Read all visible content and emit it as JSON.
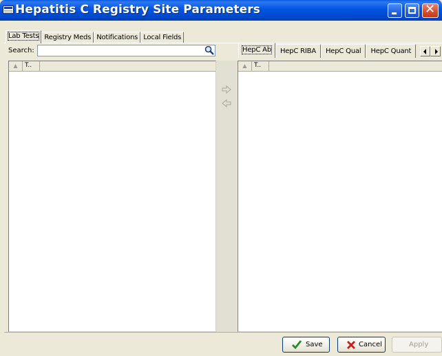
{
  "window": {
    "title": "Hepatitis C Registry Site Parameters"
  },
  "tabs": [
    {
      "label": "Lab Tests",
      "active": true
    },
    {
      "label": "Registry Meds"
    },
    {
      "label": "Notifications"
    },
    {
      "label": "Local Fields"
    }
  ],
  "search": {
    "label": "Search:",
    "value": ""
  },
  "left_grid": {
    "columns": [
      "T.."
    ]
  },
  "right_tabs": [
    {
      "label": "HepC Ab",
      "active": true
    },
    {
      "label": "HepC RIBA"
    },
    {
      "label": "HepC Qual"
    },
    {
      "label": "HepC Quant"
    }
  ],
  "right_grid": {
    "columns": [
      "T.."
    ]
  },
  "buttons": {
    "save": "Save",
    "cancel": "Cancel",
    "apply": "Apply"
  },
  "icons": {
    "search": "magnifier-icon",
    "add": "move-right-icon",
    "remove": "move-left-icon"
  },
  "colors": {
    "titlebar": "#0054e3",
    "save_check": "#2a8a2a",
    "cancel_x": "#c81e1e"
  }
}
